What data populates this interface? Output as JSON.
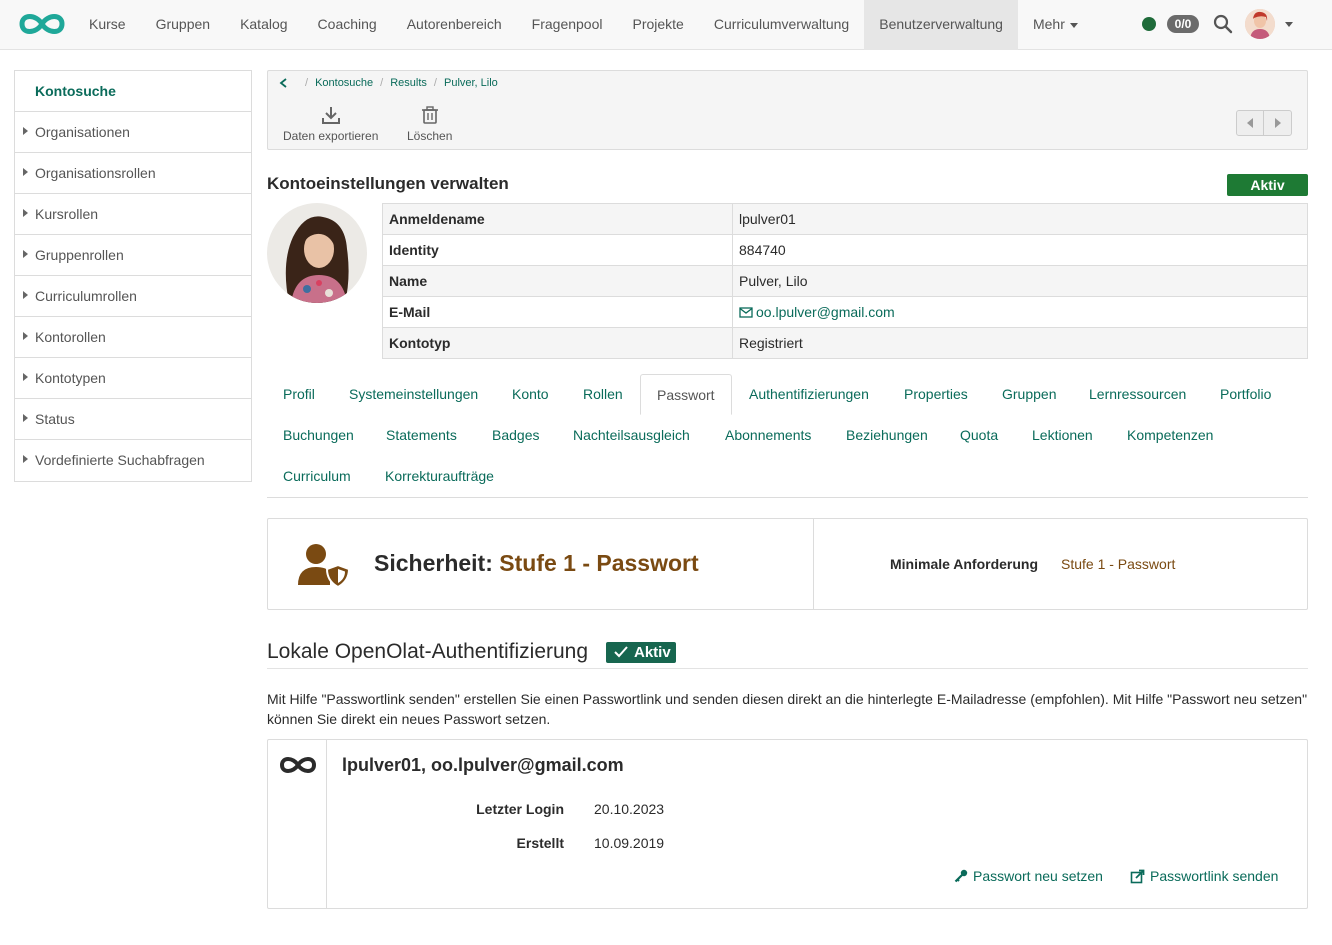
{
  "nav": {
    "items": [
      {
        "label": "Kurse"
      },
      {
        "label": "Gruppen"
      },
      {
        "label": "Katalog"
      },
      {
        "label": "Coaching"
      },
      {
        "label": "Autorenbereich"
      },
      {
        "label": "Fragenpool"
      },
      {
        "label": "Projekte"
      },
      {
        "label": "Curriculumverwaltung"
      },
      {
        "label": "Benutzerverwaltung"
      },
      {
        "label": "Mehr"
      }
    ],
    "active": "Benutzerverwaltung",
    "counter": "0/0",
    "status_color": "#1f6b3a"
  },
  "sidebar": {
    "title": "Kontosuche",
    "items": [
      {
        "label": "Organisationen"
      },
      {
        "label": "Organisationsrollen"
      },
      {
        "label": "Kursrollen"
      },
      {
        "label": "Gruppenrollen"
      },
      {
        "label": "Curriculumrollen"
      },
      {
        "label": "Kontorollen"
      },
      {
        "label": "Kontotypen"
      },
      {
        "label": "Status"
      },
      {
        "label": "Vordefinierte Suchabfragen"
      }
    ]
  },
  "breadcrumb": {
    "items": [
      "Kontosuche",
      "Results",
      "Pulver, Lilo"
    ]
  },
  "toolbar": {
    "export_label": "Daten exportieren",
    "delete_label": "Löschen"
  },
  "account": {
    "title": "Kontoeinstellungen verwalten",
    "status": "Aktiv",
    "rows": [
      {
        "key": "Anmeldename",
        "value": "lpulver01"
      },
      {
        "key": "Identity",
        "value": "884740"
      },
      {
        "key": "Name",
        "value": "Pulver, Lilo"
      },
      {
        "key": "E-Mail",
        "value": "oo.lpulver@gmail.com"
      },
      {
        "key": "Kontotyp",
        "value": "Registriert"
      }
    ]
  },
  "tabs": {
    "active": "Passwort",
    "items": [
      "Profil",
      "Systemeinstellungen",
      "Konto",
      "Rollen",
      "Passwort",
      "Authentifizierungen",
      "Properties",
      "Gruppen",
      "Lernressourcen",
      "Portfolio",
      "Buchungen",
      "Statements",
      "Badges",
      "Nachteilsausgleich",
      "Abonnements",
      "Beziehungen",
      "Quota",
      "Lektionen",
      "Kompetenzen",
      "Curriculum",
      "Korrekturaufträge"
    ]
  },
  "security": {
    "label": "Sicherheit:",
    "level": "Stufe 1 - Passwort",
    "requirement_label": "Minimale Anforderung",
    "requirement_value": "Stufe 1 - Passwort",
    "level_color": "#7a4a12"
  },
  "auth": {
    "title": "Lokale OpenOlat-Authentifizierung",
    "status": "Aktiv",
    "description": "Mit Hilfe \"Passwortlink senden\" erstellen Sie einen Passwortlink und senden diesen direkt an die hinterlegte E-Mailadresse (empfohlen). Mit Hilfe \"Passwort neu setzen\" können Sie direkt ein neues Passwort setzen.",
    "user_line": "lpulver01, oo.lpulver@gmail.com",
    "last_login_label": "Letzter Login",
    "last_login_value": "20.10.2023",
    "created_label": "Erstellt",
    "created_value": "10.09.2019",
    "reset_label": "Passwort neu setzen",
    "send_link_label": "Passwortlink senden"
  },
  "colors": {
    "accent": "#0a6b5a",
    "success": "#1e7a34"
  }
}
